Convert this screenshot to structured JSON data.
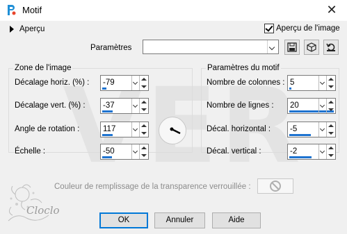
{
  "window": {
    "title": "Motif"
  },
  "preview": {
    "label": "Aperçu",
    "checkbox_label": "Aperçu de l'image",
    "checked": true
  },
  "parameters": {
    "label": "Paramètres",
    "value": ""
  },
  "image_zone": {
    "title": "Zone de l'image",
    "fields": [
      {
        "label": "Décalage horiz. (%) :",
        "value": "-79",
        "fill": 0.1
      },
      {
        "label": "Décalage vert. (%) :",
        "value": "-37",
        "fill": 0.32
      },
      {
        "label": "Angle de rotation :",
        "value": "117",
        "fill": 0.33
      },
      {
        "label": "Échelle :",
        "value": "-50",
        "fill": 0.25
      }
    ]
  },
  "motif_params": {
    "title": "Paramètres du motif",
    "fields": [
      {
        "label": "Nombre de colonnes :",
        "value": "5",
        "fill": 0.05
      },
      {
        "label": "Nombre de lignes :",
        "value": "20",
        "fill": 1.0
      },
      {
        "label": "Décal. horizontal :",
        "value": "-5",
        "fill": 0.48
      },
      {
        "label": "Décal. vertical :",
        "value": "-2",
        "fill": 0.5
      }
    ]
  },
  "fill": {
    "label": "Couleur de remplissage de la transparence verrouillée :"
  },
  "buttons": {
    "ok": "OK",
    "cancel": "Annuler",
    "help": "Aide"
  },
  "watermark": "VER",
  "logo_text": "Cloclo",
  "accent_color": "#1e73d0"
}
